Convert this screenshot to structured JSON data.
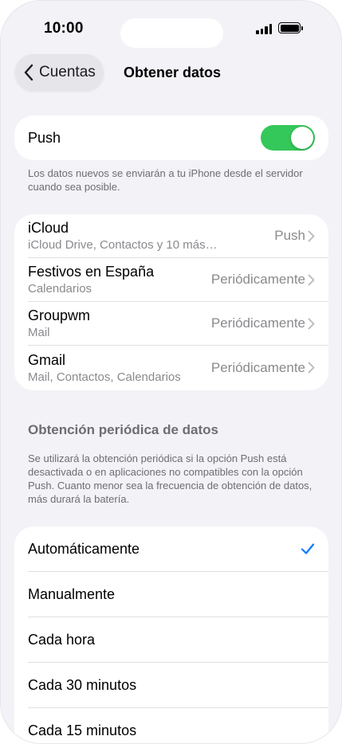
{
  "status_bar": {
    "time": "10:00"
  },
  "nav": {
    "back_label": "Cuentas",
    "title": "Obtener datos"
  },
  "push": {
    "label": "Push",
    "enabled": true,
    "footnote": "Los datos nuevos se enviarán a tu iPhone desde el servidor cuando sea posible."
  },
  "accounts": [
    {
      "name": "iCloud",
      "detail": "iCloud Drive, Contactos y 10 más…",
      "mode": "Push"
    },
    {
      "name": "Festivos en España",
      "detail": "Calendarios",
      "mode": "Periódicamente"
    },
    {
      "name": "Groupwm",
      "detail": "Mail",
      "mode": "Periódicamente"
    },
    {
      "name": "Gmail",
      "detail": "Mail, Contactos, Calendarios",
      "mode": "Periódicamente"
    }
  ],
  "fetch": {
    "header": "Obtención periódica de datos",
    "footnote": "Se utilizará la obtención periódica si la opción Push está desactivada o en aplicaciones no compatibles con la opción Push. Cuanto menor sea la frecuencia de obtención de datos, más durará la batería.",
    "options": [
      {
        "label": "Automáticamente",
        "selected": true
      },
      {
        "label": "Manualmente",
        "selected": false
      },
      {
        "label": "Cada hora",
        "selected": false
      },
      {
        "label": "Cada 30 minutos",
        "selected": false
      },
      {
        "label": "Cada 15 minutos",
        "selected": false
      }
    ]
  },
  "colors": {
    "accent": "#007aff",
    "toggle_on": "#34c759",
    "background": "#f2f2f7"
  }
}
